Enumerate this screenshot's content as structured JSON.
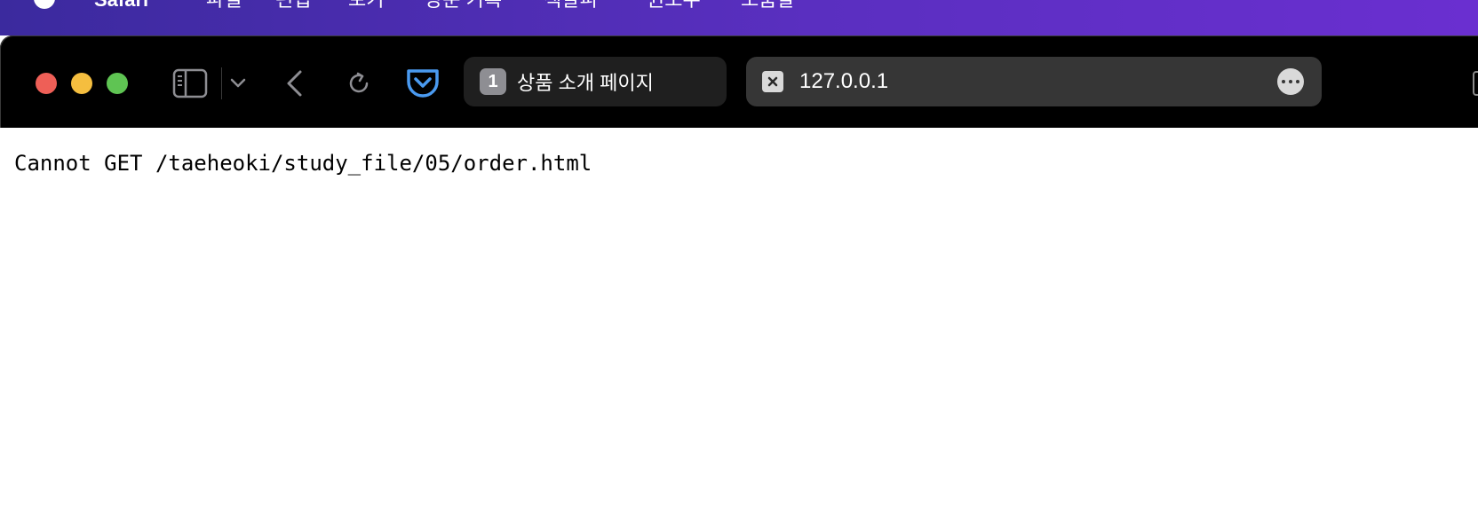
{
  "menubar": {
    "app_name": "Safari",
    "items": [
      "파일",
      "편집",
      "보기",
      "방문 기록",
      "책갈피",
      "윈도우",
      "도움말"
    ]
  },
  "toolbar": {
    "tab": {
      "count_badge": "1",
      "title": "상품 소개 페이지"
    },
    "address": {
      "url": "127.0.0.1"
    }
  },
  "page": {
    "error_message": "Cannot GET /taeheoki/study_file/05/order.html"
  },
  "colors": {
    "menubar_gradient_start": "#3b2a9e",
    "menubar_gradient_end": "#6a2fd0",
    "toolbar_bg": "#000000",
    "address_bar_bg": "#363636",
    "pocket_accent": "#4a9af0",
    "traffic_close": "#ee5f57",
    "traffic_minimize": "#f5be3f",
    "traffic_zoom": "#5fc453"
  },
  "icons": [
    "apple-icon",
    "sidebar-icon",
    "chevron-down-icon",
    "back-icon",
    "reload-icon",
    "pocket-icon",
    "close-tab-icon",
    "more-icon"
  ]
}
